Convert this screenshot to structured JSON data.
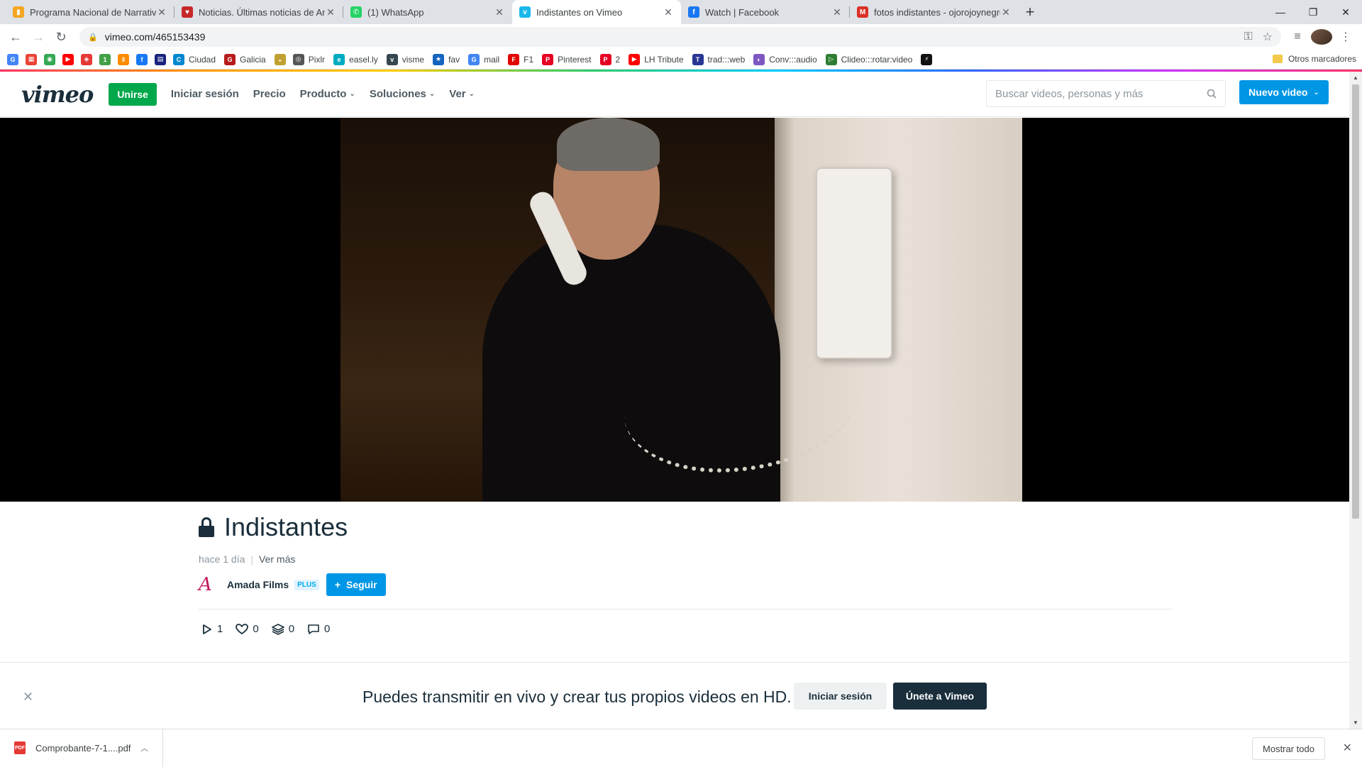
{
  "browser": {
    "tabs": [
      {
        "title": "Programa Nacional de Narrativas",
        "icon": "orange-document-icon",
        "color": "#f5a623",
        "glyph": "▮"
      },
      {
        "title": "Noticias. Últimas noticias de Arg",
        "icon": "heart-icon",
        "color": "#c62828",
        "glyph": "♥"
      },
      {
        "title": "(1) WhatsApp",
        "icon": "whatsapp-icon",
        "color": "#25d366",
        "glyph": "✆"
      },
      {
        "title": "Indistantes on Vimeo",
        "icon": "vimeo-icon",
        "color": "#1ab7ea",
        "glyph": "v"
      },
      {
        "title": "Watch | Facebook",
        "icon": "facebook-icon",
        "color": "#1877f2",
        "glyph": "f"
      },
      {
        "title": "fotos indistantes - ojorojoynegro",
        "icon": "gmail-icon",
        "color": "#d93025",
        "glyph": "M"
      }
    ],
    "active_tab": 3,
    "url": "vimeo.com/465153439",
    "bookmarks": [
      {
        "label": "",
        "icon": "google-icon",
        "color": "#4285f4",
        "glyph": "G"
      },
      {
        "label": "",
        "icon": "apps-grid-icon",
        "color": "#ea4335",
        "glyph": "▦"
      },
      {
        "label": "",
        "icon": "maps-pin-icon",
        "color": "#34a853",
        "glyph": "◉"
      },
      {
        "label": "",
        "icon": "youtube-icon",
        "color": "#ff0000",
        "glyph": "▶"
      },
      {
        "label": "",
        "icon": "red-swirl-icon",
        "color": "#e53935",
        "glyph": "◈"
      },
      {
        "label": "",
        "icon": "green-one-icon",
        "color": "#43a047",
        "glyph": "1"
      },
      {
        "label": "",
        "icon": "orange-bars-icon",
        "color": "#fb8c00",
        "glyph": "‖"
      },
      {
        "label": "",
        "icon": "facebook-icon",
        "color": "#1877f2",
        "glyph": "f"
      },
      {
        "label": "",
        "icon": "news-icon",
        "color": "#1a237e",
        "glyph": "▤"
      },
      {
        "label": "Ciudad",
        "icon": "ciudad-icon",
        "color": "#0288d1",
        "glyph": "C"
      },
      {
        "label": "Galicia",
        "icon": "galicia-icon",
        "color": "#b71c1c",
        "glyph": "G"
      },
      {
        "label": "",
        "icon": "food-icon",
        "color": "#c0a030",
        "glyph": "◒"
      },
      {
        "label": "Pixlr",
        "icon": "pixlr-icon",
        "color": "#555555",
        "glyph": "◎"
      },
      {
        "label": "easel.ly",
        "icon": "easelly-icon",
        "color": "#00acc1",
        "glyph": "e"
      },
      {
        "label": "visme",
        "icon": "visme-icon",
        "color": "#37474f",
        "glyph": "v"
      },
      {
        "label": "fav",
        "icon": "star-icon",
        "color": "#1565c0",
        "glyph": "★"
      },
      {
        "label": "mail",
        "icon": "google-icon",
        "color": "#4285f4",
        "glyph": "G"
      },
      {
        "label": "F1",
        "icon": "f1-icon",
        "color": "#e10600",
        "glyph": "F"
      },
      {
        "label": "Pinterest",
        "icon": "pinterest-icon",
        "color": "#e60023",
        "glyph": "P"
      },
      {
        "label": "2",
        "icon": "pinterest-icon",
        "color": "#e60023",
        "glyph": "P"
      },
      {
        "label": "LH Tribute",
        "icon": "youtube-icon",
        "color": "#ff0000",
        "glyph": "▶"
      },
      {
        "label": "trad:::web",
        "icon": "tradweb-icon",
        "color": "#283593",
        "glyph": "T"
      },
      {
        "label": "Conv:::audio",
        "icon": "convaudio-icon",
        "color": "#7e57c2",
        "glyph": "◐"
      },
      {
        "label": "Clideo:::rotar:video",
        "icon": "clideo-icon",
        "color": "#2e7d32",
        "glyph": "▷"
      },
      {
        "label": "",
        "icon": "yellow-black-icon",
        "color": "#111111",
        "glyph": "⚡"
      }
    ],
    "other_bookmarks": "Otros marcadores"
  },
  "vimeo": {
    "header": {
      "logo": "vimeo",
      "join": "Unirse",
      "login": "Iniciar sesión",
      "pricing": "Precio",
      "product": "Producto",
      "solutions": "Soluciones",
      "watch": "Ver",
      "search_placeholder": "Buscar videos, personas y más",
      "new_video": "Nuevo video"
    },
    "video": {
      "title": "Indistantes",
      "posted": "hace 1 día",
      "see_more": "Ver más",
      "owner": "Amada Films",
      "owner_badge": "PLUS",
      "follow": "Seguir",
      "stats": {
        "plays": "1",
        "likes": "0",
        "collections": "0",
        "comments": "0"
      }
    },
    "banner": {
      "text": "Puedes transmitir en vivo y crear tus propios videos en HD.",
      "login": "Iniciar sesión",
      "join": "Únete a Vimeo"
    }
  },
  "downloads": {
    "file": "Comprobante-7-1....pdf",
    "file_type": "PDF",
    "show_all": "Mostrar todo"
  },
  "colors": {
    "vimeo_blue": "#0096e6",
    "join_green": "#00a84b",
    "dark_navy": "#1a2e3b"
  }
}
